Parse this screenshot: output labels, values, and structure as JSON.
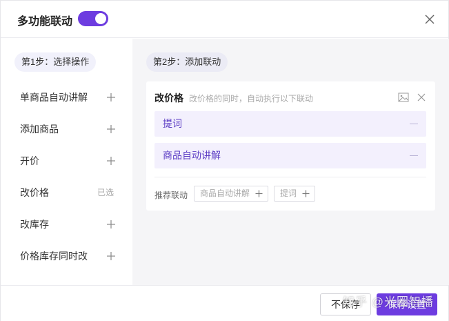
{
  "header": {
    "title": "多功能联动",
    "toggle_on": true
  },
  "left_panel": {
    "step_label": "第1步：选择操作",
    "items": [
      {
        "label": "单商品自动讲解",
        "state": "add"
      },
      {
        "label": "添加商品",
        "state": "add"
      },
      {
        "label": "开价",
        "state": "add"
      },
      {
        "label": "改价格",
        "state": "selected",
        "status_text": "已选"
      },
      {
        "label": "改库存",
        "state": "add"
      },
      {
        "label": "价格库存同时改",
        "state": "add"
      }
    ]
  },
  "right_panel": {
    "step_label": "第2步：添加联动",
    "card": {
      "title": "改价格",
      "description": "改价格的同时，自动执行以下联动",
      "linked_actions": [
        {
          "label": "提词"
        },
        {
          "label": "商品自动讲解"
        }
      ],
      "recommend_label": "推荐联动",
      "recommend_chips": [
        {
          "label": "商品自动讲解"
        },
        {
          "label": "提词"
        }
      ]
    }
  },
  "footer": {
    "cancel_label": "不保存",
    "save_label": "保存设置"
  },
  "watermark": "知乎 @光圈智播",
  "colors": {
    "accent": "#6d3ce0",
    "linked_row_bg": "#f3f0fd",
    "linked_row_text": "#5b3cc4",
    "panel_bg": "#f5f5f7"
  },
  "icons": {
    "close": "close-icon",
    "plus": "plus-icon",
    "minus": "minus-icon",
    "image": "image-icon"
  }
}
